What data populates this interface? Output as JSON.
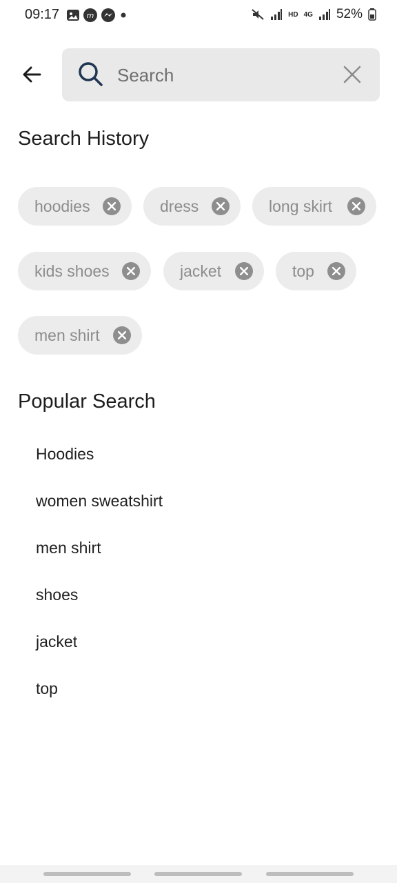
{
  "status_bar": {
    "time": "09:17",
    "battery": "52%",
    "left_icons": [
      "gallery-icon",
      "m-app-icon",
      "messenger-icon",
      "dot-icon"
    ],
    "right_icons": [
      "mute-icon",
      "signal-icon",
      "hd-icon",
      "4g-icon",
      "signal-icon-2",
      "battery-icon"
    ],
    "network_label": "HD",
    "network_type": "4G"
  },
  "search": {
    "placeholder": "Search",
    "value": ""
  },
  "history": {
    "title": "Search History",
    "chips": [
      "hoodies",
      "dress",
      "long skirt",
      "kids shoes",
      "jacket",
      "top",
      "men shirt"
    ]
  },
  "popular": {
    "title": "Popular Search",
    "items": [
      "Hoodies",
      "women sweatshirt",
      "men shirt",
      "shoes",
      "jacket",
      "top"
    ]
  },
  "colors": {
    "chip_bg": "#ececec",
    "chip_text": "#8c8c8c",
    "search_bg": "#e9e9e9",
    "search_icon": "#1f3552"
  }
}
